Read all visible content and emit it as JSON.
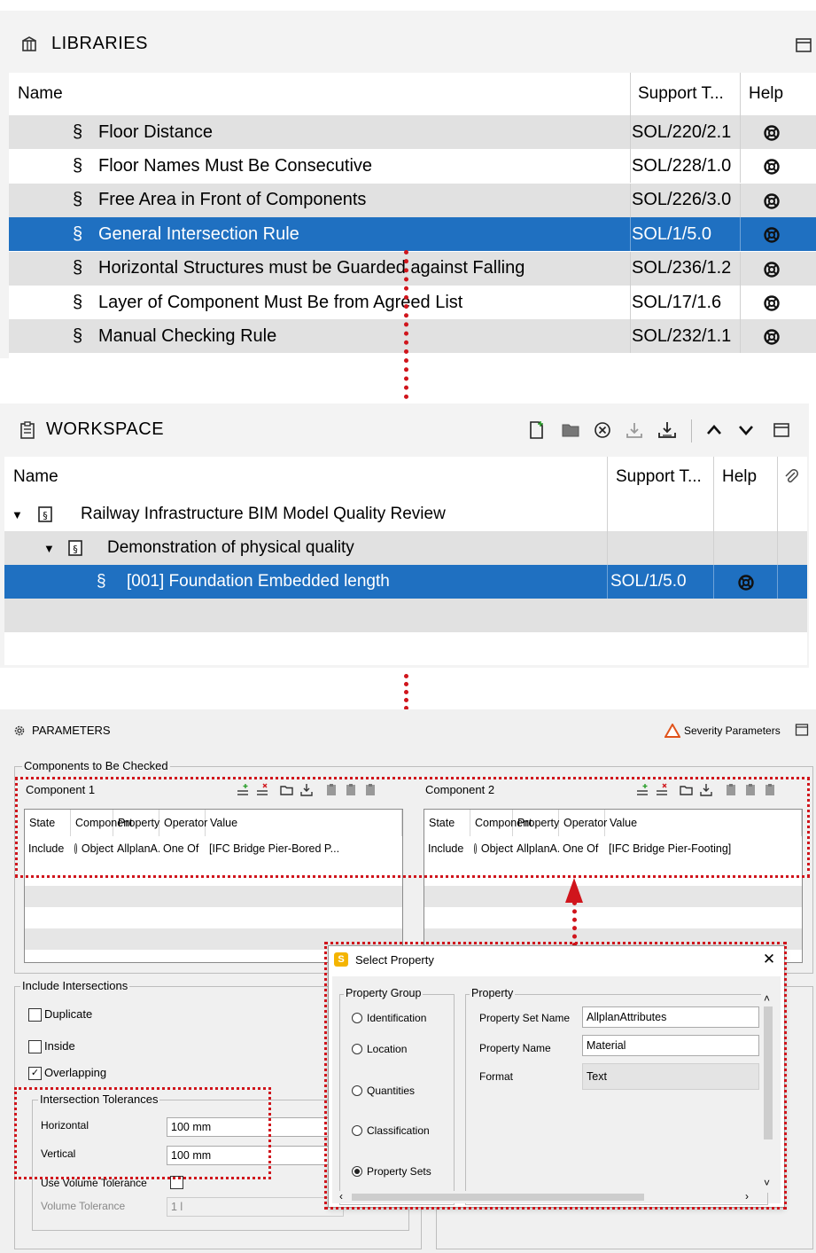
{
  "libraries": {
    "title": "LIBRARIES",
    "columns": {
      "name": "Name",
      "support": "Support T...",
      "help": "Help"
    },
    "rows": [
      {
        "name": "Floor Distance",
        "support": "SOL/220/2.1"
      },
      {
        "name": "Floor Names Must Be Consecutive",
        "support": "SOL/228/1.0"
      },
      {
        "name": "Free Area in Front of Components",
        "support": "SOL/226/3.0"
      },
      {
        "name": "General Intersection Rule",
        "support": "SOL/1/5.0",
        "selected": true
      },
      {
        "name": "Horizontal Structures must be Guarded against Falling",
        "support": "SOL/236/1.2"
      },
      {
        "name": "Layer of Component Must Be from Agreed List",
        "support": "SOL/17/1.6"
      },
      {
        "name": "Manual Checking Rule",
        "support": "SOL/232/1.1"
      }
    ],
    "section_symbol": "§"
  },
  "workspace": {
    "title": "WORKSPACE",
    "columns": {
      "name": "Name",
      "support": "Support T...",
      "help": "Help"
    },
    "rows": [
      {
        "name": "Railway Infrastructure BIM Model Quality Review",
        "support": ""
      },
      {
        "name": "Demonstration of physical quality",
        "support": ""
      },
      {
        "name": "[001] Foundation Embedded length",
        "support": "SOL/1/5.0",
        "selected": true
      }
    ]
  },
  "parameters": {
    "title": "PARAMETERS",
    "severity": "Severity Parameters",
    "components_group": "Components to Be Checked",
    "component1": {
      "title": "Component 1",
      "headers": [
        "State",
        "Component",
        "Property",
        "Operator",
        "Value"
      ],
      "row": [
        "Include",
        "Object",
        "AllplanA...",
        "One Of",
        "[IFC Bridge Pier-Bored P..."
      ]
    },
    "component2": {
      "title": "Component 2",
      "headers": [
        "State",
        "Component",
        "Property",
        "Operator",
        "Value"
      ],
      "row": [
        "Include",
        "Object",
        "AllplanA...",
        "One Of",
        "[IFC Bridge Pier-Footing]"
      ]
    },
    "intersections": {
      "title": "Include Intersections",
      "duplicate": "Duplicate",
      "inside": "Inside",
      "overlapping": "Overlapping",
      "tolerances_title": "Intersection Tolerances",
      "horizontal_label": "Horizontal",
      "horizontal_value": "100 mm",
      "vertical_label": "Vertical",
      "vertical_value": "100 mm",
      "use_volume": "Use Volume Tolerance",
      "volume_label": "Volume Tolerance",
      "volume_value": "1 l"
    }
  },
  "dialog": {
    "title": "Select Property",
    "group_title": "Property Group",
    "groups": [
      "Identification",
      "Location",
      "Quantities",
      "Classification",
      "Property Sets"
    ],
    "selected_group": "Property Sets",
    "property_title": "Property",
    "set_name_label": "Property Set Name",
    "set_name_value": "AllplanAttributes",
    "prop_name_label": "Property Name",
    "prop_name_value": "Material",
    "format_label": "Format",
    "format_value": "Text"
  },
  "colors": {
    "selection": "#1f70c1",
    "annotation": "#d0151c",
    "row_alt": "#e1e1e1"
  }
}
